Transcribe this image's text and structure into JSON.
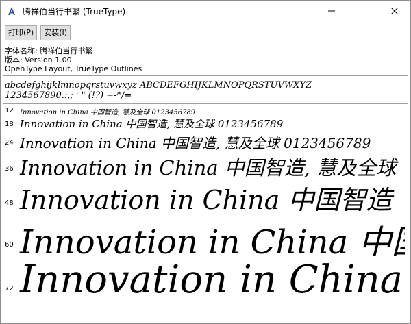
{
  "window": {
    "title": "腾祥伯当行书繁 (TrueType)",
    "icon": "font-file-icon"
  },
  "toolbar": {
    "print_label": "打印(P)",
    "install_label": "安装(I)"
  },
  "info": {
    "font_name": "字体名称: 腾祥伯当行书繁",
    "version": "版本: Version  1.00",
    "layout": "OpenType Layout, TrueType Outlines"
  },
  "sample": {
    "lowercase": "abcdefghijklmnopqrstuvwxyz  ABCDEFGHIJKLMNOPQRSTUVWXYZ",
    "digits": "1234567890.:,; ' \" (!?) +-*/="
  },
  "size_rows": [
    {
      "size": "12",
      "text": "Innovation in China 中国智造, 慧及全球 0123456789"
    },
    {
      "size": "18",
      "text": "Innovation in China 中国智造, 慧及全球 0123456789"
    },
    {
      "size": "24",
      "text": "Innovation in China 中国智造, 慧及全球 0123456789"
    },
    {
      "size": "36",
      "text": "Innovation in China 中国智造, 慧及全球"
    },
    {
      "size": "48",
      "text": "Innovation in China 中国智造"
    },
    {
      "size": "60",
      "text": "Innovation in China 中国"
    },
    {
      "size": "72",
      "text": "Innovation in China"
    }
  ]
}
